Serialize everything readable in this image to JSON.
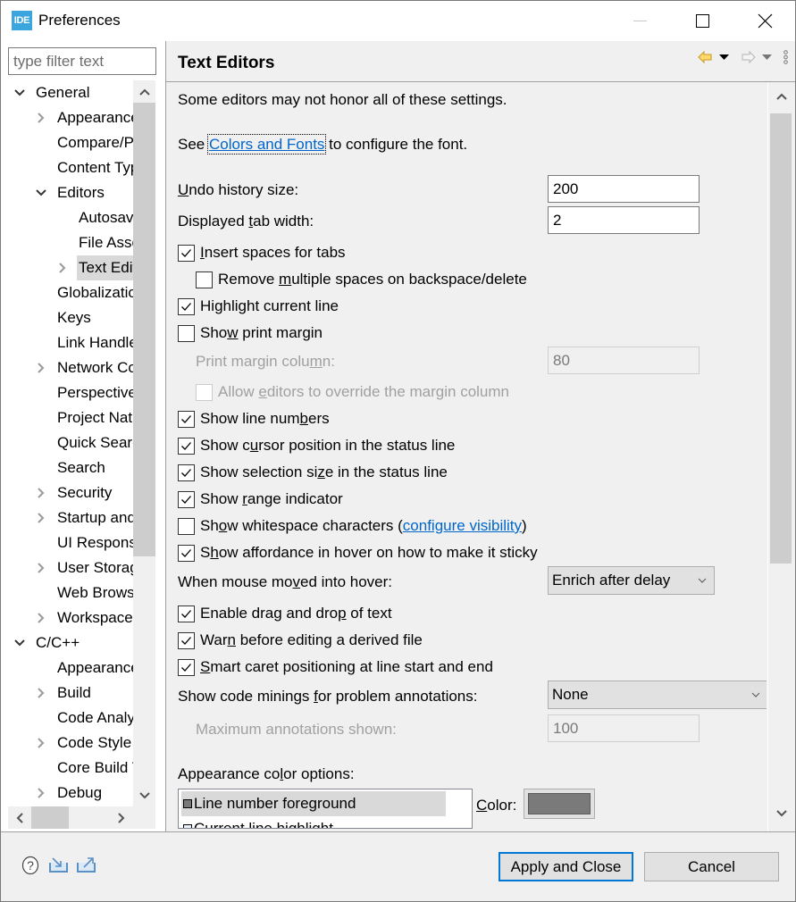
{
  "window": {
    "app_icon_text": "IDE",
    "title": "Preferences"
  },
  "filter": {
    "placeholder": "type filter text",
    "value": ""
  },
  "tree": {
    "items": [
      {
        "label": "General",
        "level": 0,
        "expander": "expanded"
      },
      {
        "label": "Appearance",
        "level": 1,
        "expander": "collapsed"
      },
      {
        "label": "Compare/Patch",
        "level": 1,
        "expander": "none"
      },
      {
        "label": "Content Types",
        "level": 1,
        "expander": "none"
      },
      {
        "label": "Editors",
        "level": 1,
        "expander": "expanded"
      },
      {
        "label": "Autosave",
        "level": 2,
        "expander": "none"
      },
      {
        "label": "File Associations",
        "level": 2,
        "expander": "none"
      },
      {
        "label": "Text Editors",
        "level": 2,
        "expander": "collapsed",
        "selected": true
      },
      {
        "label": "Globalization",
        "level": 1,
        "expander": "none"
      },
      {
        "label": "Keys",
        "level": 1,
        "expander": "none"
      },
      {
        "label": "Link Handlers",
        "level": 1,
        "expander": "none"
      },
      {
        "label": "Network Connections",
        "level": 1,
        "expander": "collapsed"
      },
      {
        "label": "Perspectives",
        "level": 1,
        "expander": "none"
      },
      {
        "label": "Project Natures",
        "level": 1,
        "expander": "none"
      },
      {
        "label": "Quick Search",
        "level": 1,
        "expander": "none"
      },
      {
        "label": "Search",
        "level": 1,
        "expander": "none"
      },
      {
        "label": "Security",
        "level": 1,
        "expander": "collapsed"
      },
      {
        "label": "Startup and Shutdown",
        "level": 1,
        "expander": "collapsed"
      },
      {
        "label": "UI Responsiveness",
        "level": 1,
        "expander": "none"
      },
      {
        "label": "User Storage",
        "level": 1,
        "expander": "collapsed"
      },
      {
        "label": "Web Browser",
        "level": 1,
        "expander": "none"
      },
      {
        "label": "Workspace",
        "level": 1,
        "expander": "collapsed"
      },
      {
        "label": "C/C++",
        "level": 0,
        "expander": "expanded"
      },
      {
        "label": "Appearance",
        "level": 1,
        "expander": "none"
      },
      {
        "label": "Build",
        "level": 1,
        "expander": "collapsed"
      },
      {
        "label": "Code Analysis",
        "level": 1,
        "expander": "none"
      },
      {
        "label": "Code Style",
        "level": 1,
        "expander": "collapsed"
      },
      {
        "label": "Core Build Toolchains",
        "level": 1,
        "expander": "none"
      },
      {
        "label": "Debug",
        "level": 1,
        "expander": "collapsed"
      }
    ]
  },
  "header": {
    "title": "Text Editors",
    "icons": [
      "back-arrow-icon",
      "back-menu-icon",
      "forward-arrow-icon",
      "forward-menu-icon",
      "view-menu-icon"
    ]
  },
  "content": {
    "note": "Some editors may not honor all of these settings.",
    "see_prefix": "See ",
    "colors_link": "Colors and Fonts",
    "see_suffix": " to configure the font.",
    "undo_label": {
      "pre": "",
      "u": "U",
      "post": "ndo history size:"
    },
    "undo_value": "200",
    "tab_label": {
      "pre": "Displayed ",
      "u": "t",
      "post": "ab width:"
    },
    "tab_value": "2",
    "checkboxes": [
      {
        "pre": "",
        "u": "I",
        "post": "nsert spaces for tabs",
        "checked": true,
        "enabled": true
      },
      {
        "pre": "Remove ",
        "u": "m",
        "post": "ultiple spaces on backspace/delete",
        "checked": false,
        "enabled": true
      },
      {
        "pre": "Hi",
        "u": "g",
        "post": "hlight current line",
        "checked": true,
        "enabled": true
      },
      {
        "pre": "Sho",
        "u": "w",
        "post": " print margin",
        "checked": false,
        "enabled": true
      },
      {
        "pre": "Allow ",
        "u": "e",
        "post": "ditors to override the margin column",
        "checked": false,
        "enabled": false
      },
      {
        "pre": "Show line num",
        "u": "b",
        "post": "ers",
        "checked": true,
        "enabled": true
      },
      {
        "pre": "Show c",
        "u": "u",
        "post": "rsor position in the status line",
        "checked": true,
        "enabled": true
      },
      {
        "pre": "Show selection si",
        "u": "z",
        "post": "e in the status line",
        "checked": true,
        "enabled": true
      },
      {
        "pre": "Show ",
        "u": "r",
        "post": "ange indicator",
        "checked": true,
        "enabled": true
      },
      {
        "pre": "Sh",
        "u": "o",
        "post": "w whitespace characters (",
        "checked": false,
        "enabled": true,
        "link": "configure visibility",
        "after": ")"
      },
      {
        "pre": "S",
        "u": "h",
        "post": "ow affordance in hover on how to make it sticky",
        "checked": true,
        "enabled": true
      },
      {
        "pre": "Enable drag and dro",
        "u": "p",
        "post": " of text",
        "checked": true,
        "enabled": true
      },
      {
        "pre": "War",
        "u": "n",
        "post": " before editing a derived file",
        "checked": true,
        "enabled": true
      },
      {
        "pre": "",
        "u": "S",
        "post": "mart caret positioning at line start and end",
        "checked": true,
        "enabled": true
      }
    ],
    "print_margin_label": {
      "pre": "Print margin colu",
      "u": "m",
      "post": "n:"
    },
    "print_margin_value": "80",
    "hover_label": {
      "pre": "When mouse mo",
      "u": "v",
      "post": "ed into hover:"
    },
    "hover_value": "Enrich after delay",
    "minings_label": {
      "pre": "Show code minings ",
      "u": "f",
      "post": "or problem annotations:"
    },
    "minings_value": "None",
    "max_annotations_label": "Maximum annotations shown:",
    "max_annotations_value": "100",
    "appearance_label": {
      "pre": "Appearance co",
      "u": "l",
      "post": "or options:"
    },
    "appearance_items": [
      {
        "label": "Line number foreground",
        "selected": true,
        "swatch": "#7a7a7a"
      },
      {
        "label": "Current line highlight",
        "selected": false,
        "swatch": "#e8f2fe"
      }
    ],
    "color_label": {
      "pre": "",
      "u": "C",
      "post": "olor:"
    },
    "color_value": "#7a7a7a"
  },
  "footer": {
    "icons": [
      "help-icon",
      "import-icon",
      "export-icon"
    ],
    "apply_close": "Apply and Close",
    "cancel": "Cancel"
  }
}
